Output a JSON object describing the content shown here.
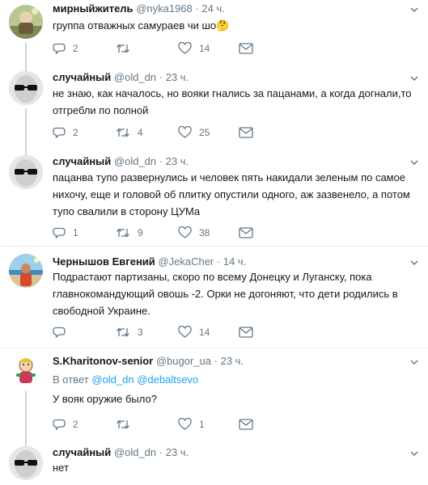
{
  "tweets": [
    {
      "name": "мирныйжитель",
      "handle": "@nyka1968",
      "time": "24 ч.",
      "text": "группа отважных самураев чи шо🤔",
      "replies": "2",
      "retweets": "",
      "likes": "14",
      "avatar": "painting"
    },
    {
      "name": "случайный",
      "handle": "@old_dn",
      "time": "23 ч.",
      "text": "не знаю, как началось, но вояки гнались за пацанами, а когда догнали,то отгребли по полной",
      "replies": "2",
      "retweets": "4",
      "likes": "25",
      "avatar": "sunglasses"
    },
    {
      "name": "случайный",
      "handle": "@old_dn",
      "time": "23 ч.",
      "text": "пацанва тупо развернулись и человек пять накидали зеленым по самое нихочу, еще и головой об плитку опустили одного, аж зазвенело, а потом тупо свалили в сторону ЦУМа",
      "replies": "1",
      "retweets": "9",
      "likes": "38",
      "avatar": "sunglasses"
    },
    {
      "name": "Чернышов Евгений",
      "handle": "@JekaCher",
      "time": "14 ч.",
      "text": "Подрастают партизаны, скоро по всему Донецку и Луганску, пока главнокомандующий овошь -2. Орки не догоняют, что дети родились в свободной Украине.",
      "replies": "",
      "retweets": "3",
      "likes": "14",
      "avatar": "beach"
    },
    {
      "name": "S.Kharitonov-senior",
      "handle": "@bugor_ua",
      "time": "23 ч.",
      "reply_prefix": "В ответ",
      "reply_mentions": [
        "@old_dn",
        "@debaltsevo"
      ],
      "text": "У вояк оружие было?",
      "replies": "2",
      "retweets": "",
      "likes": "1",
      "avatar": "cartoon"
    },
    {
      "name": "случайный",
      "handle": "@old_dn",
      "time": "23 ч.",
      "text": "нет",
      "avatar": "sunglasses"
    }
  ],
  "icons": {
    "reply": "reply-icon",
    "retweet": "retweet-icon",
    "like": "heart-icon",
    "dm": "envelope-icon",
    "more": "chevron-down-icon"
  },
  "colors": {
    "text": "#14171a",
    "secondary": "#657786",
    "link": "#1da1f2",
    "divider": "#e6ecf0",
    "thread_line": "#ccd6dd"
  }
}
